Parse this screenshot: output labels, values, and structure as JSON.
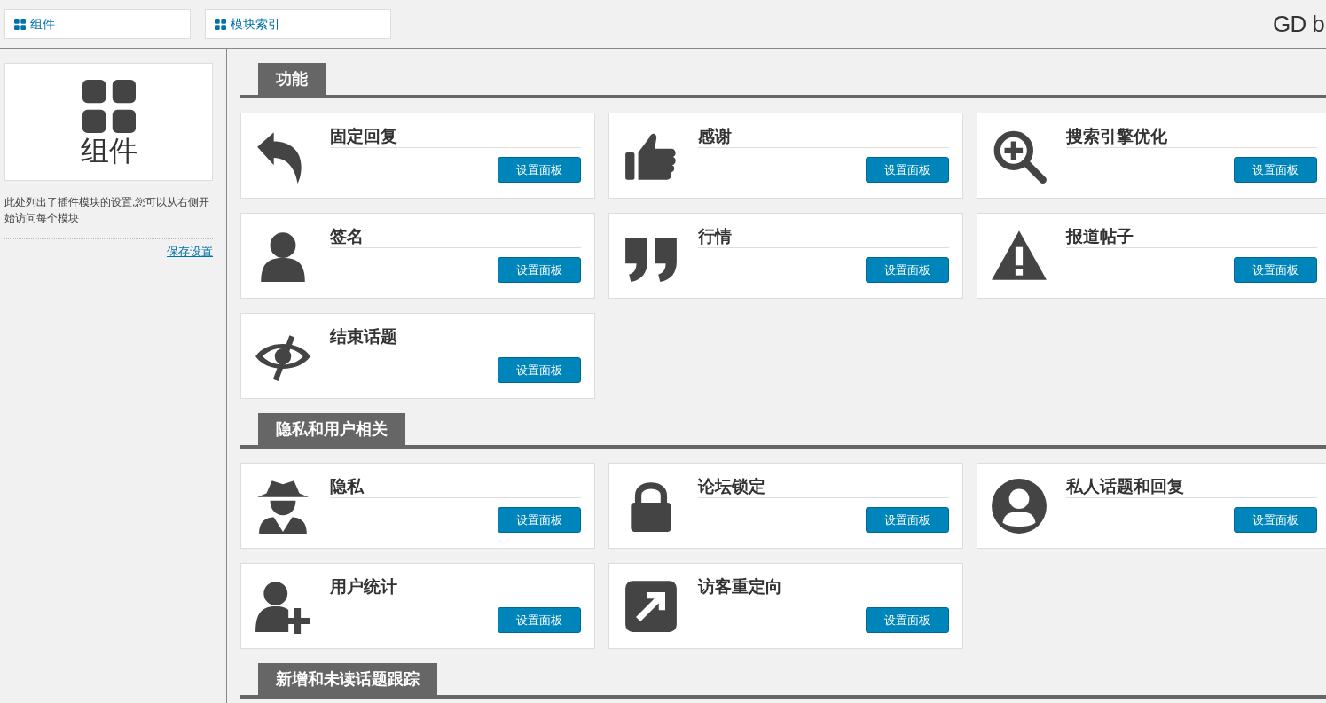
{
  "top_tabs": [
    {
      "label": "组件"
    },
    {
      "label": "模块索引"
    }
  ],
  "brand": "GD b",
  "sidebar": {
    "title": "组件",
    "description": "此处列出了插件模块的设置,您可以从右侧开始访问每个模块",
    "save_link": "保存设置"
  },
  "sections": [
    {
      "title": "功能",
      "modules": [
        {
          "kind": "reply",
          "title": "固定回复",
          "button": "设置面板"
        },
        {
          "kind": "thumbs-up",
          "title": "感谢",
          "button": "设置面板"
        },
        {
          "kind": "zoom",
          "title": "搜索引擎优化",
          "button": "设置面板"
        },
        {
          "kind": "user",
          "title": "签名",
          "button": "设置面板"
        },
        {
          "kind": "quote",
          "title": "行情",
          "button": "设置面板"
        },
        {
          "kind": "warning",
          "title": "报道帖子",
          "button": "设置面板"
        },
        {
          "kind": "eye-slash",
          "title": "结束话题",
          "button": "设置面板"
        }
      ]
    },
    {
      "title": "隐私和用户相关",
      "modules": [
        {
          "kind": "spy",
          "title": "隐私",
          "button": "设置面板"
        },
        {
          "kind": "lock",
          "title": "论坛锁定",
          "button": "设置面板"
        },
        {
          "kind": "user-circle",
          "title": "私人话题和回复",
          "button": "设置面板"
        },
        {
          "kind": "user-plus",
          "title": "用户统计",
          "button": "设置面板"
        },
        {
          "kind": "external",
          "title": "访客重定向",
          "button": "设置面板"
        }
      ]
    },
    {
      "title": "新增和未读话题跟踪"
    }
  ]
}
